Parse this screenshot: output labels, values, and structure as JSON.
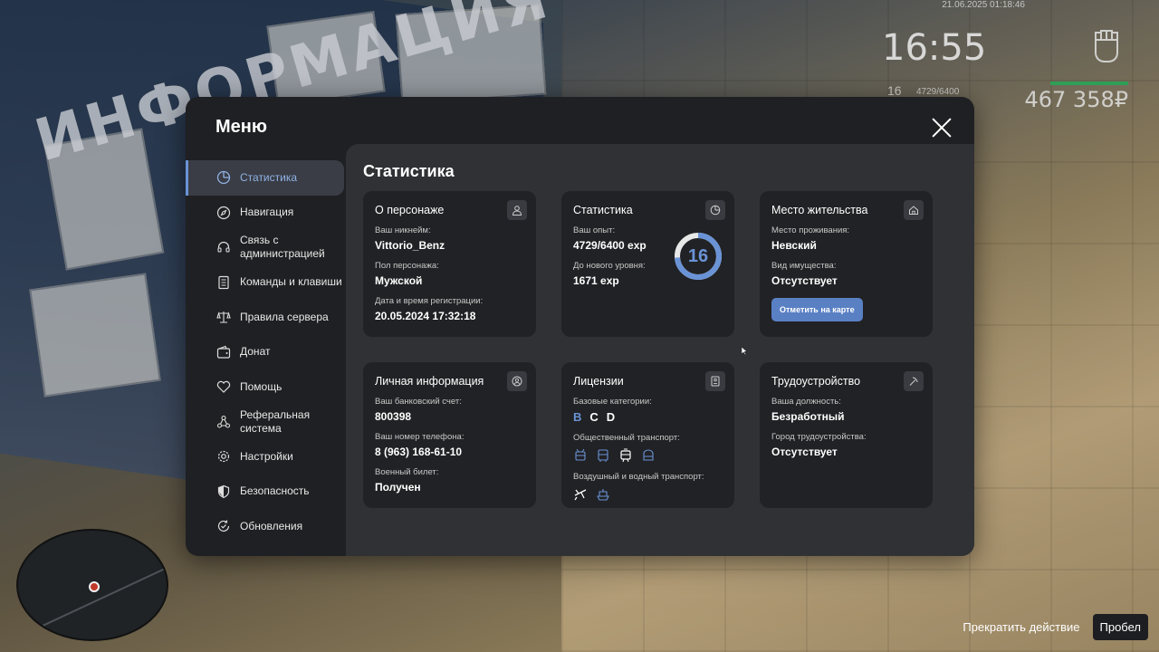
{
  "hud": {
    "datetime": "21.06.2025 01:18:46",
    "time": "16:55",
    "level": "16",
    "exp": "4729/6400",
    "money": "467 358₽"
  },
  "hint": {
    "action": "Прекратить действие",
    "key": "Пробел"
  },
  "menu": {
    "title": "Меню",
    "sidebar": [
      {
        "label": "Статистика",
        "icon": "pie-chart-icon"
      },
      {
        "label": "Навигация",
        "icon": "compass-icon"
      },
      {
        "label": "Связь с администрацией",
        "icon": "headset-icon"
      },
      {
        "label": "Команды и клавиши",
        "icon": "document-icon"
      },
      {
        "label": "Правила сервера",
        "icon": "scales-icon"
      },
      {
        "label": "Донат",
        "icon": "wallet-icon"
      },
      {
        "label": "Помощь",
        "icon": "handshake-heart-icon"
      },
      {
        "label": "Реферальная система",
        "icon": "network-icon"
      },
      {
        "label": "Настройки",
        "icon": "gear-icon"
      },
      {
        "label": "Безопасность",
        "icon": "shield-icon"
      },
      {
        "label": "Обновления",
        "icon": "refresh-check-icon"
      }
    ],
    "active_index": 0,
    "content_title": "Статистика",
    "cards": {
      "character": {
        "title": "О персонаже",
        "nickname_label": "Ваш никнейм:",
        "nickname": "Vittorio_Benz",
        "gender_label": "Пол персонажа:",
        "gender": "Мужской",
        "reg_label": "Дата и время регистрации:",
        "reg": "20.05.2024 17:32:18"
      },
      "stats": {
        "title": "Статистика",
        "exp_label": "Ваш опыт:",
        "exp": "4729/6400 exp",
        "next_label": "До нового уровня:",
        "next": "1671 exp",
        "level": "16",
        "progress": 0.739
      },
      "residence": {
        "title": "Место жительства",
        "place_label": "Место проживания:",
        "place": "Невский",
        "property_label": "Вид имущества:",
        "property": "Отсутствует",
        "button": "Отметить на карте"
      },
      "personal": {
        "title": "Личная информация",
        "bank_label": "Ваш банковский счет:",
        "bank": "800398",
        "phone_label": "Ваш номер телефона:",
        "phone": "8 (963) 168-61-10",
        "military_label": "Военный билет:",
        "military": "Получен"
      },
      "licenses": {
        "title": "Лицензии",
        "base_label": "Базовые категории:",
        "categories": [
          "B",
          "C",
          "D"
        ],
        "public_label": "Общественный транспорт:",
        "air_label": "Воздушный и водный транспорт:"
      },
      "job": {
        "title": "Трудоустройство",
        "position_label": "Ваша должность:",
        "position": "Безработный",
        "city_label": "Город трудоустройства:",
        "city": "Отсутствует"
      }
    }
  },
  "colors": {
    "accent": "#6a93d6",
    "panel": "#1f2023",
    "content": "#303134",
    "card": "#212225"
  }
}
